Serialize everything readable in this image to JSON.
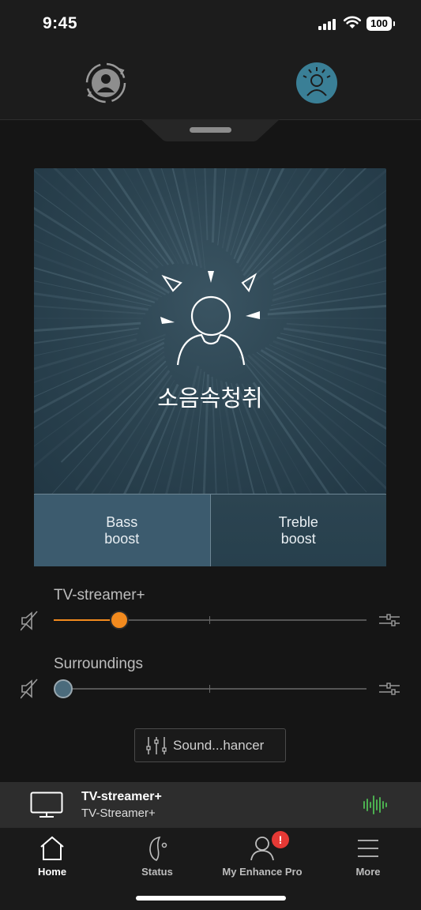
{
  "status_bar": {
    "time": "9:45",
    "battery": "100"
  },
  "hero": {
    "title": "소음속청취"
  },
  "tabs": [
    {
      "label": "Bass\nboost",
      "line1": "Bass",
      "line2": "boost",
      "selected": true
    },
    {
      "label": "Treble\nboost",
      "line1": "Treble",
      "line2": "boost",
      "selected": false
    }
  ],
  "sliders": {
    "tv": {
      "label": "TV-streamer+",
      "value_fraction": 0.21,
      "accent": "#f28a1e"
    },
    "surroundings": {
      "label": "Surroundings",
      "value_fraction": 0.03,
      "accent": "#4b6b7c"
    }
  },
  "enhancer_button": {
    "label": "Sound...hancer"
  },
  "now_playing": {
    "title": "TV-streamer+",
    "subtitle": "TV-Streamer+",
    "wave_color": "#4caf50"
  },
  "nav": [
    {
      "label": "Home",
      "icon": "home-icon",
      "active": true
    },
    {
      "label": "Status",
      "icon": "hearing-aid-icon",
      "active": false
    },
    {
      "label": "My Enhance Pro",
      "icon": "person-icon",
      "active": false,
      "badge": "!"
    },
    {
      "label": "More",
      "icon": "menu-icon",
      "active": false
    }
  ],
  "colors": {
    "accent_teal": "#3a7f96",
    "accent_orange": "#f28a1e"
  }
}
